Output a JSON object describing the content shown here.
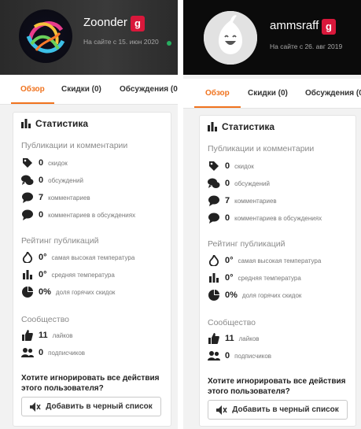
{
  "left": {
    "username": "Zoonder",
    "badge": "g",
    "since": "На сайте с 15. июн 2020",
    "tabs": [
      "Обзор",
      "Скидки (0)",
      "Обсуждения (0"
    ],
    "stats": {
      "title": "Статистика",
      "section_pubs": "Публикации и комментарии",
      "deals_num": "0",
      "deals_label": "скидок",
      "discussions_num": "0",
      "discussions_label": "обсуждений",
      "comments_num": "7",
      "comments_label": "комментариев",
      "disc_comments_num": "0",
      "disc_comments_label": "комментариев в обсуждениях",
      "section_rating": "Рейтинг публикаций",
      "max_temp_num": "0°",
      "max_temp_label": "самая высокая температура",
      "avg_temp_num": "0°",
      "avg_temp_label": "средняя температура",
      "hot_share_num": "0%",
      "hot_share_label": "доля горячих скидок",
      "section_community": "Сообщество",
      "likes_num": "11",
      "likes_label": "лайков",
      "followers_num": "0",
      "followers_label": "подписчиков",
      "ignore_question": "Хотите игнорировать все действия этого пользователя?",
      "blacklist_button": "Добавить в черный список"
    }
  },
  "right": {
    "username": "ammsraff",
    "badge": "g",
    "since": "На сайте с 26. авг 2019",
    "tabs": [
      "Обзор",
      "Скидки (0)",
      "Обсуждения (0"
    ],
    "stats": {
      "title": "Статистика",
      "section_pubs": "Публикации и комментарии",
      "deals_num": "0",
      "deals_label": "скидок",
      "discussions_num": "0",
      "discussions_label": "обсуждений",
      "comments_num": "7",
      "comments_label": "комментариев",
      "disc_comments_num": "0",
      "disc_comments_label": "комментариев в обсуждениях",
      "section_rating": "Рейтинг публикаций",
      "max_temp_num": "0°",
      "max_temp_label": "самая высокая температура",
      "avg_temp_num": "0°",
      "avg_temp_label": "средняя температура",
      "hot_share_num": "0%",
      "hot_share_label": "доля горячих скидок",
      "section_community": "Сообщество",
      "likes_num": "11",
      "likes_label": "лайков",
      "followers_num": "0",
      "followers_label": "подписчиков",
      "ignore_question": "Хотите игнорировать все действия этого пользователя?",
      "blacklist_button": "Добавить в черный список"
    }
  },
  "colors": {
    "accent": "#f0731e",
    "badge": "#d9183b",
    "online": "#27ae60"
  },
  "icons": [
    "bar-chart-icon",
    "tag-icon",
    "discussions-icon",
    "comment-icon",
    "flame-icon",
    "likes-icon",
    "followers-icon",
    "mute-icon"
  ]
}
